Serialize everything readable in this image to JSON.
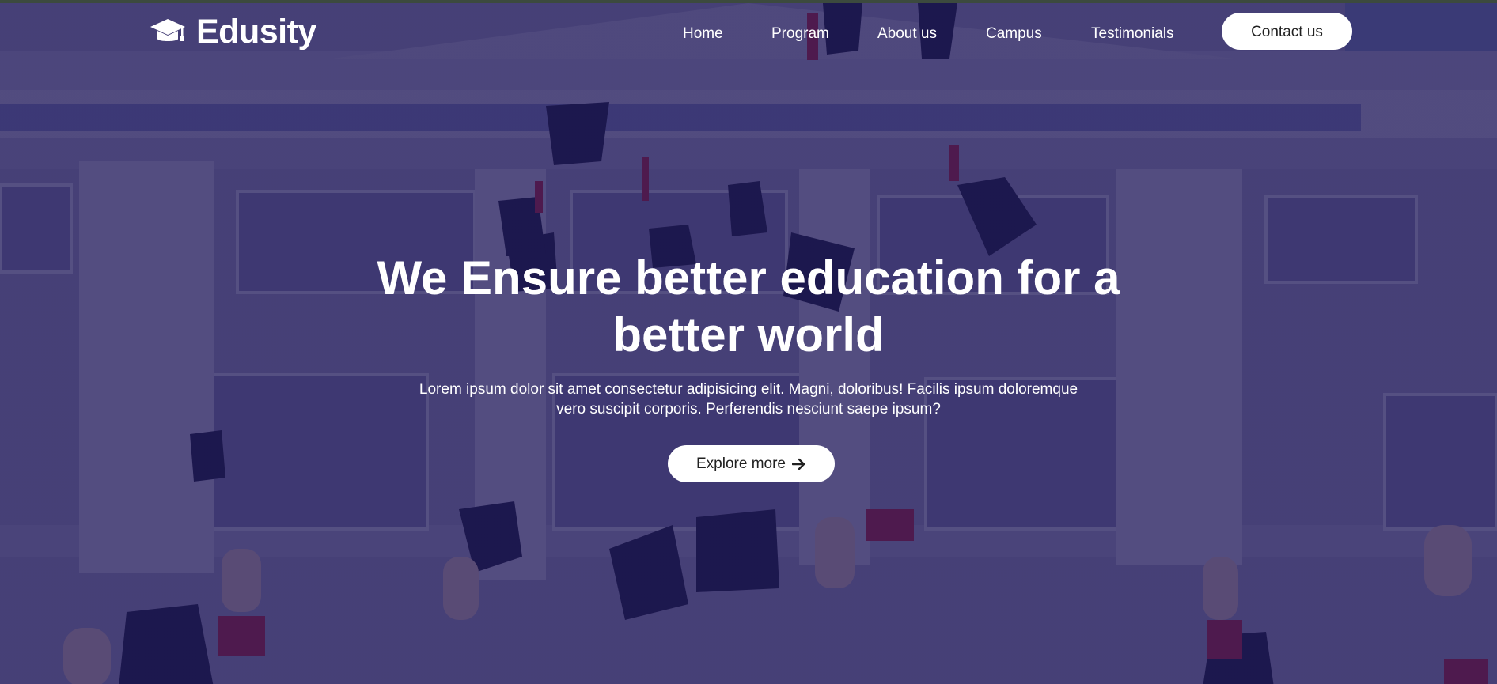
{
  "brand": {
    "name": "Edusity",
    "icon": "graduation-cap-icon"
  },
  "nav": {
    "items": [
      {
        "label": "Home"
      },
      {
        "label": "Program"
      },
      {
        "label": "About us"
      },
      {
        "label": "Campus"
      },
      {
        "label": "Testimonials"
      }
    ],
    "contact_label": "Contact us"
  },
  "hero": {
    "title": "We Ensure better education for a better world",
    "subtitle": "Lorem ipsum dolor sit amet consectetur adipisicing elit. Magni, doloribus! Facilis ipsum doloremque vero suscipit corporis. Perferendis nesciunt saepe ipsum?",
    "cta_label": "Explore more",
    "cta_icon": "arrow-right-icon",
    "background": "university-building-graduation-caps-photo"
  },
  "colors": {
    "overlay": "#1c1655",
    "button_bg": "#ffffff",
    "button_text": "#212121",
    "text": "#ffffff"
  }
}
